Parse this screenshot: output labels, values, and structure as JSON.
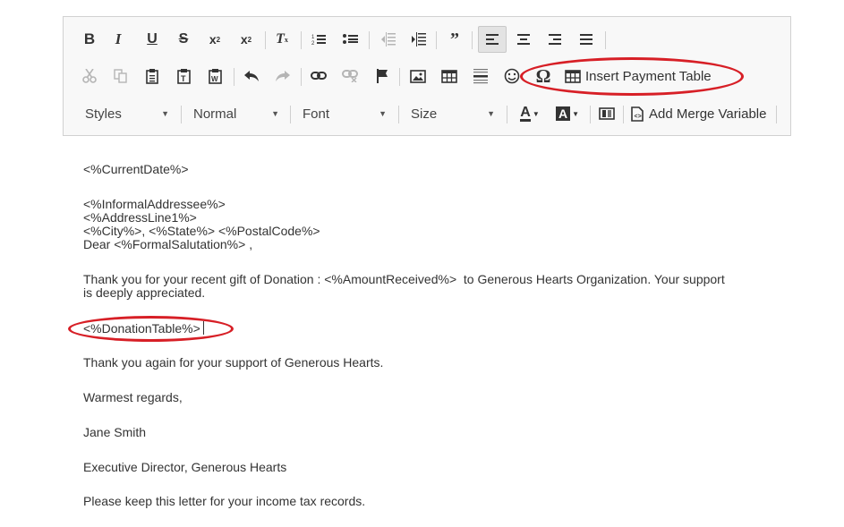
{
  "toolbar": {
    "row1": [
      {
        "name": "bold-icon",
        "glyph": "B"
      },
      {
        "name": "italic-icon",
        "glyph": "I"
      },
      {
        "name": "underline-icon",
        "glyph": "U"
      },
      {
        "name": "strikethrough-icon",
        "glyph": "S"
      },
      {
        "name": "subscript-icon",
        "glyph": "x₂"
      },
      {
        "name": "superscript-icon",
        "glyph": "x²"
      },
      {
        "name": "remove-format-icon",
        "glyph": "Tx"
      },
      {
        "name": "numbered-list-icon"
      },
      {
        "name": "bulleted-list-icon"
      },
      {
        "name": "decrease-indent-icon"
      },
      {
        "name": "increase-indent-icon"
      },
      {
        "name": "blockquote-icon",
        "glyph": "❞"
      },
      {
        "name": "align-left-icon"
      },
      {
        "name": "align-center-icon"
      },
      {
        "name": "align-right-icon"
      },
      {
        "name": "justify-icon"
      }
    ],
    "row2": [
      {
        "name": "cut-icon"
      },
      {
        "name": "copy-icon"
      },
      {
        "name": "paste-icon"
      },
      {
        "name": "paste-text-icon"
      },
      {
        "name": "paste-word-icon"
      },
      {
        "name": "undo-icon"
      },
      {
        "name": "redo-icon"
      },
      {
        "name": "link-icon"
      },
      {
        "name": "unlink-icon"
      },
      {
        "name": "anchor-flag-icon"
      },
      {
        "name": "image-icon"
      },
      {
        "name": "table-icon"
      },
      {
        "name": "horizontal-line-icon"
      },
      {
        "name": "smiley-icon",
        "glyph": "☺"
      },
      {
        "name": "special-char-icon",
        "glyph": "Ω"
      }
    ],
    "insert_payment_table_label": "Insert Payment Table",
    "styles_label": "Styles",
    "format_label": "Normal",
    "font_label": "Font",
    "size_label": "Size",
    "text_color_glyph": "A",
    "bg_color_glyph": "A",
    "add_merge_variable_label": "Add Merge Variable"
  },
  "document": {
    "current_date": "<%CurrentDate%>",
    "addressee": "<%InformalAddressee%>",
    "address_line1": "<%AddressLine1%>",
    "city_state_postal": "<%City%>, <%State%> <%PostalCode%>",
    "salutation": "Dear <%FormalSalutation%> ,",
    "thanks_line1": "Thank you for your recent gift of Donation : <%AmountReceived%>  to Generous Hearts Organization. Your support",
    "thanks_line2": "is deeply appreciated.",
    "donation_table": "<%DonationTable%>",
    "thanks_again": "Thank you again for your support of Generous Hearts.",
    "closing": "Warmest regards,",
    "signer_name": "Jane Smith",
    "signer_title": "Executive Director, Generous Hearts",
    "footer_note": "Please keep this letter for your income tax records."
  },
  "colors": {
    "annotation_ring": "#d71f26",
    "toolbar_bg": "#f8f8f8"
  }
}
